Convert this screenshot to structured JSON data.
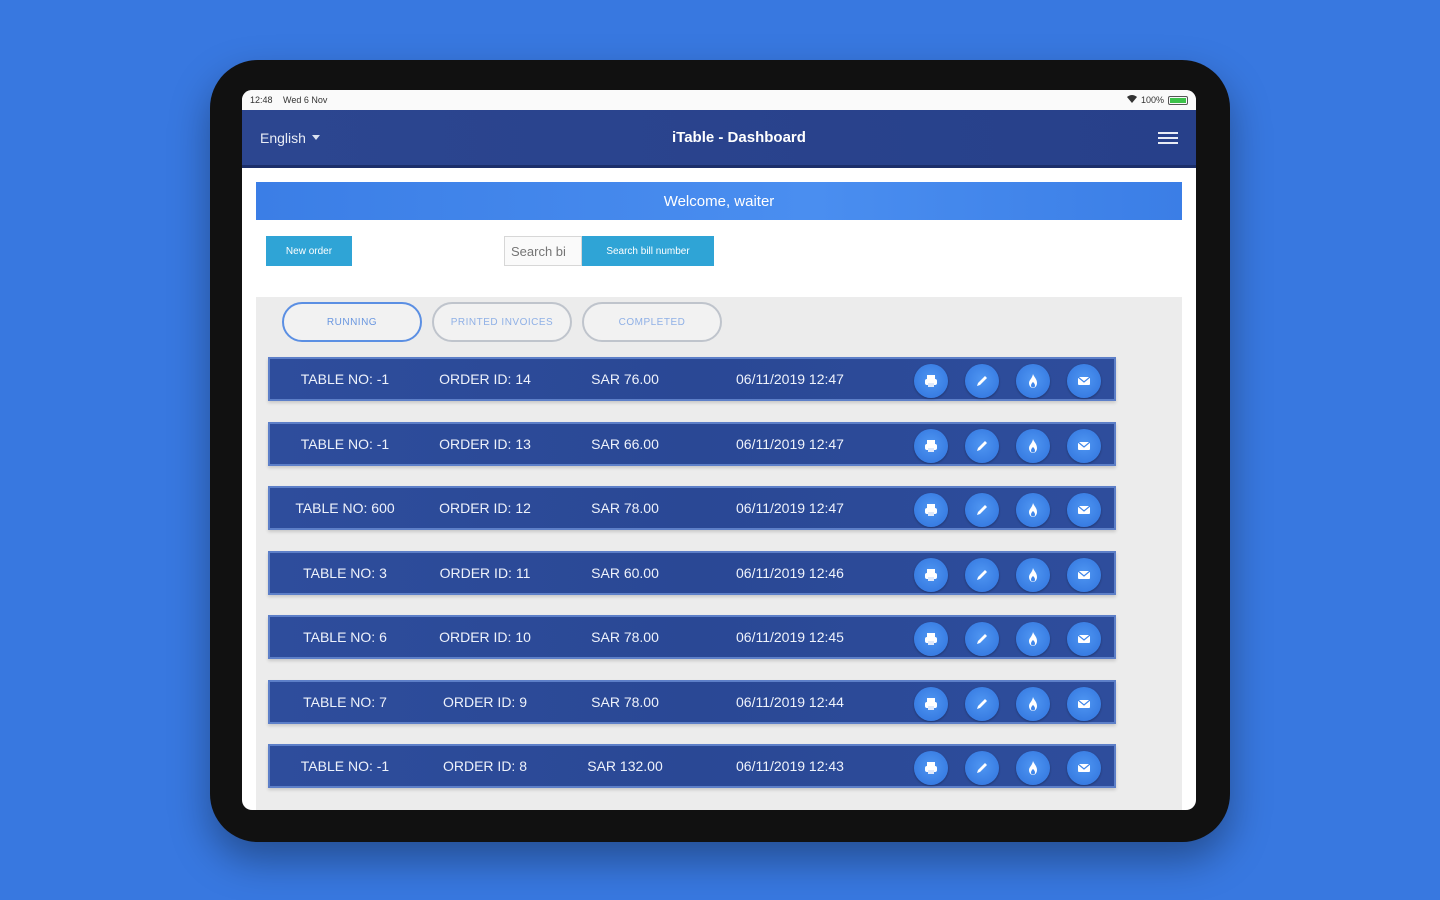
{
  "status_bar": {
    "time": "12:48",
    "date": "Wed 6 Nov",
    "battery": "100%"
  },
  "navbar": {
    "language": "English",
    "title": "iTable - Dashboard"
  },
  "welcome": "Welcome, waiter",
  "actions": {
    "new_order_label": "New order",
    "search_placeholder": "Search bi",
    "search_button_label": "Search bill number"
  },
  "tabs": [
    {
      "label": "RUNNING",
      "active": true
    },
    {
      "label": "PRINTED INVOICES",
      "active": false
    },
    {
      "label": "COMPLETED",
      "active": false
    }
  ],
  "orders": [
    {
      "table": "TABLE NO: -1",
      "order": "ORDER ID: 14",
      "amount": "SAR 76.00",
      "date": "06/11/2019 12:47"
    },
    {
      "table": "TABLE NO: -1",
      "order": "ORDER ID: 13",
      "amount": "SAR 66.00",
      "date": "06/11/2019 12:47"
    },
    {
      "table": "TABLE NO: 600",
      "order": "ORDER ID: 12",
      "amount": "SAR 78.00",
      "date": "06/11/2019 12:47"
    },
    {
      "table": "TABLE NO: 3",
      "order": "ORDER ID: 11",
      "amount": "SAR 60.00",
      "date": "06/11/2019 12:46"
    },
    {
      "table": "TABLE NO: 6",
      "order": "ORDER ID: 10",
      "amount": "SAR 78.00",
      "date": "06/11/2019 12:45"
    },
    {
      "table": "TABLE NO: 7",
      "order": "ORDER ID: 9",
      "amount": "SAR 78.00",
      "date": "06/11/2019 12:44"
    },
    {
      "table": "TABLE NO: -1",
      "order": "ORDER ID: 8",
      "amount": "SAR 132.00",
      "date": "06/11/2019 12:43"
    }
  ],
  "row_icons": [
    "print-icon",
    "edit-icon",
    "fire-icon",
    "mail-icon"
  ],
  "colors": {
    "background": "#3878e0",
    "navbar": "#2c4690",
    "welcome_bar": "#3b7ee6",
    "action_button": "#2fa4d6",
    "order_row": "#2e4d9c",
    "icon_button": "#3f86ea"
  }
}
